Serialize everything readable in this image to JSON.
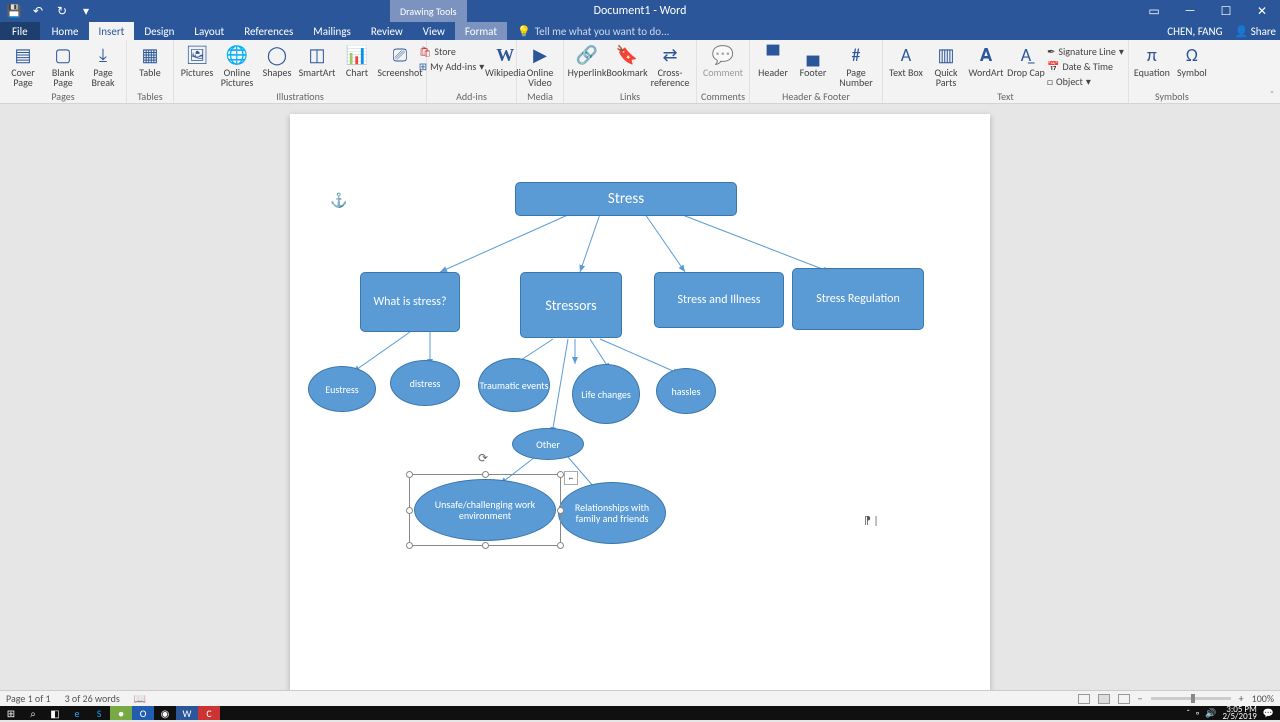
{
  "app": {
    "title": "Document1 - Word",
    "ctx_tab_group": "Drawing Tools",
    "ctx_tab": "Format",
    "user": "CHEN, FANG",
    "share": "Share",
    "tellme": "Tell me what you want to do..."
  },
  "tabs": {
    "file": "File",
    "home": "Home",
    "insert": "Insert",
    "design": "Design",
    "layout": "Layout",
    "references": "References",
    "mailings": "Mailings",
    "review": "Review",
    "view": "View"
  },
  "ribbon": {
    "pages": {
      "cover": "Cover Page",
      "blank": "Blank Page",
      "break": "Page Break",
      "label": "Pages"
    },
    "tables": {
      "table": "Table",
      "label": "Tables"
    },
    "illus": {
      "pictures": "Pictures",
      "online": "Online Pictures",
      "shapes": "Shapes",
      "smartart": "SmartArt",
      "chart": "Chart",
      "screenshot": "Screenshot",
      "label": "Illustrations"
    },
    "addins": {
      "store": "Store",
      "my": "My Add-ins",
      "wiki": "Wikipedia",
      "label": "Add-ins"
    },
    "media": {
      "video": "Online Video",
      "label": "Media"
    },
    "links": {
      "hyper": "Hyperlink",
      "bookmark": "Bookmark",
      "xref": "Cross-reference",
      "label": "Links"
    },
    "comments": {
      "comment": "Comment",
      "label": "Comments"
    },
    "hf": {
      "header": "Header",
      "footer": "Footer",
      "page": "Page Number",
      "label": "Header & Footer"
    },
    "text": {
      "tbox": "Text Box",
      "quick": "Quick Parts",
      "wart": "WordArt",
      "drop": "Drop Cap",
      "sig": "Signature Line",
      "date": "Date & Time",
      "obj": "Object",
      "label": "Text"
    },
    "symbols": {
      "eq": "Equation",
      "sym": "Symbol",
      "label": "Symbols"
    }
  },
  "diagram": {
    "root": "Stress",
    "l1": {
      "a": "What is stress?",
      "b": "Stressors",
      "c": "Stress and Illness",
      "d": "Stress Regulation"
    },
    "l2": {
      "a": "Eustress",
      "b": "distress",
      "c": "Traumatic events",
      "d": "Life changes",
      "e": "hassles"
    },
    "l3": "Other",
    "l4": {
      "a": "Unsafe/challenging work environment",
      "b": "Relationships with family and friends"
    }
  },
  "status": {
    "page": "Page 1 of 1",
    "words": "3 of 26 words",
    "zoom": "100%"
  },
  "clock": {
    "time": "3:05 PM",
    "date": "2/5/2019"
  }
}
